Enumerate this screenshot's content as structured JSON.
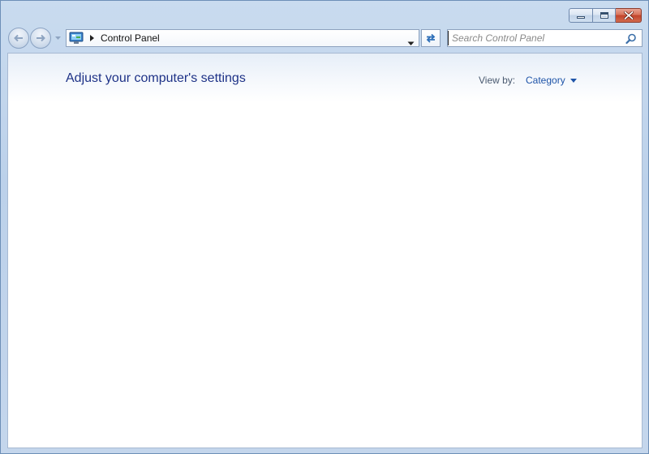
{
  "window": {
    "controls": {
      "minimize_icon": "minimize-icon",
      "maximize_icon": "restore-icon",
      "close_icon": "close-icon"
    }
  },
  "navigation": {
    "back_icon": "back-arrow-icon",
    "forward_icon": "forward-arrow-icon",
    "recent_icon": "chevron-down-icon"
  },
  "address_bar": {
    "location_icon": "control-panel-icon",
    "breadcrumb": [
      "Control Panel"
    ],
    "dropdown_icon": "chevron-down-icon",
    "refresh_icon": "refresh-icon"
  },
  "search": {
    "placeholder": "Search Control Panel",
    "value": "",
    "icon": "search-icon"
  },
  "content": {
    "title": "Adjust your computer's settings",
    "view_by_label": "View by:",
    "view_by_value": "Category"
  },
  "colors": {
    "title": "#1e3287",
    "link": "#1e54a8",
    "close_button": "#c2442b",
    "frame": "#bcd1ea"
  }
}
